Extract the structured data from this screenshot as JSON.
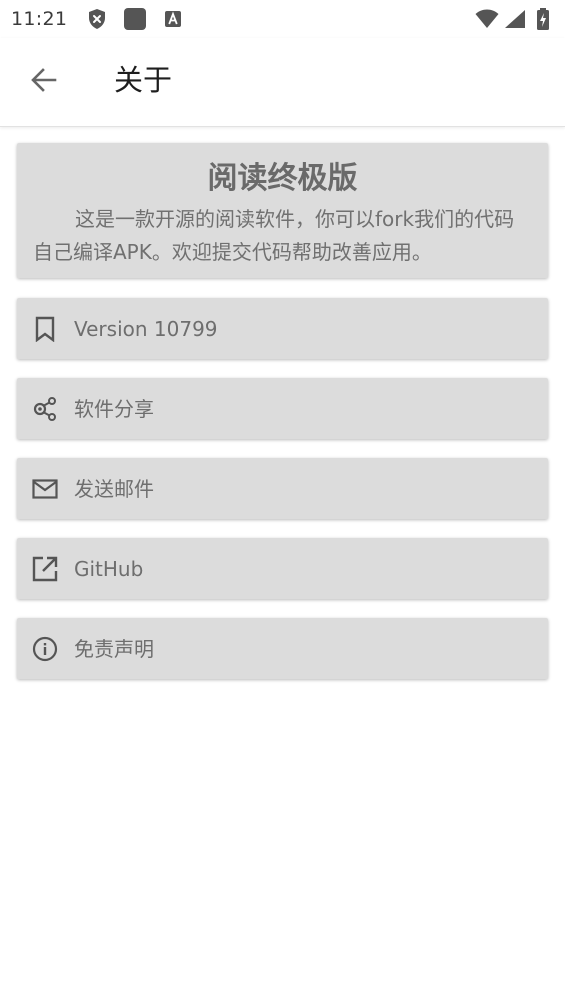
{
  "status_bar": {
    "time": "11:21",
    "icons": [
      "shield-x-icon",
      "square-icon",
      "font-a-icon",
      "wifi-icon",
      "signal-icon",
      "battery-icon"
    ]
  },
  "app_bar": {
    "back_icon": "arrow-back-icon",
    "title": "关于"
  },
  "about": {
    "title": "阅读终极版",
    "description": "这是一款开源的阅读软件，你可以fork我们的代码自己编译APK。欢迎提交代码帮助改善应用。"
  },
  "items": [
    {
      "icon": "bookmark-icon",
      "label": "Version 10799"
    },
    {
      "icon": "share-icon",
      "label": "软件分享"
    },
    {
      "icon": "mail-icon",
      "label": "发送邮件"
    },
    {
      "icon": "open-external-icon",
      "label": "GitHub"
    },
    {
      "icon": "info-icon",
      "label": "免责声明"
    }
  ],
  "colors": {
    "card_bg": "#dcdcdc",
    "icon": "#555555",
    "text": "#6e6e6e"
  }
}
